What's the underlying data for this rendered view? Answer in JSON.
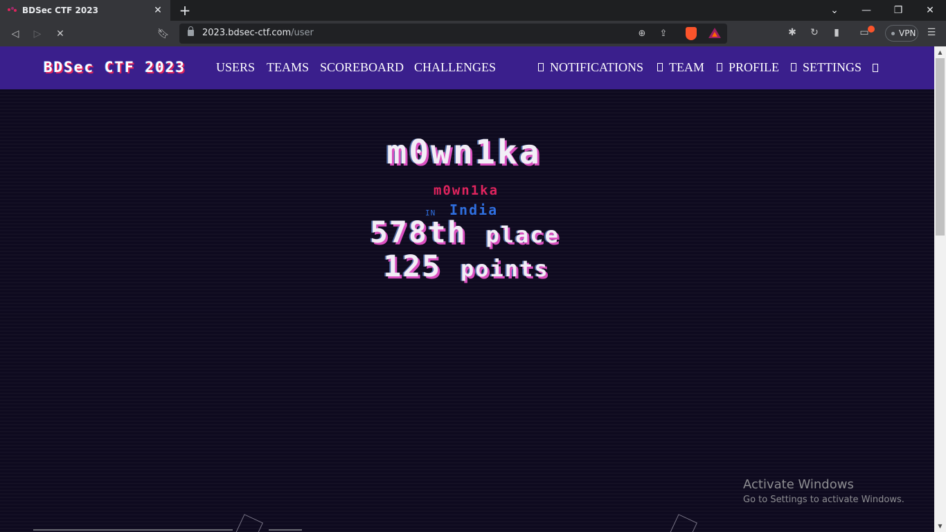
{
  "browser": {
    "tab_title": "BDSec CTF 2023",
    "url_domain": "2023.bdsec-ctf.com",
    "url_path": "/user",
    "vpn_label": "VPN"
  },
  "nav": {
    "brand": "BDSec CTF 2023",
    "links": [
      "USERS",
      "TEAMS",
      "SCOREBOARD",
      "CHALLENGES"
    ],
    "right_links": [
      "NOTIFICATIONS",
      "TEAM",
      "PROFILE",
      "SETTINGS"
    ]
  },
  "profile": {
    "username": "m0wn1ka",
    "affiliation": "m0wn1ka",
    "in_label": "IN",
    "country": "India",
    "place_number": "578th",
    "place_word": "place",
    "points_number": "125",
    "points_word": "points"
  },
  "watermark": {
    "title": "Activate Windows",
    "subtitle": "Go to Settings to activate Windows."
  },
  "colors": {
    "navbar": "#3a1f8c",
    "page_bg": "#0e0a1f",
    "affiliation": "#e0245e",
    "country": "#2f6fe0"
  }
}
